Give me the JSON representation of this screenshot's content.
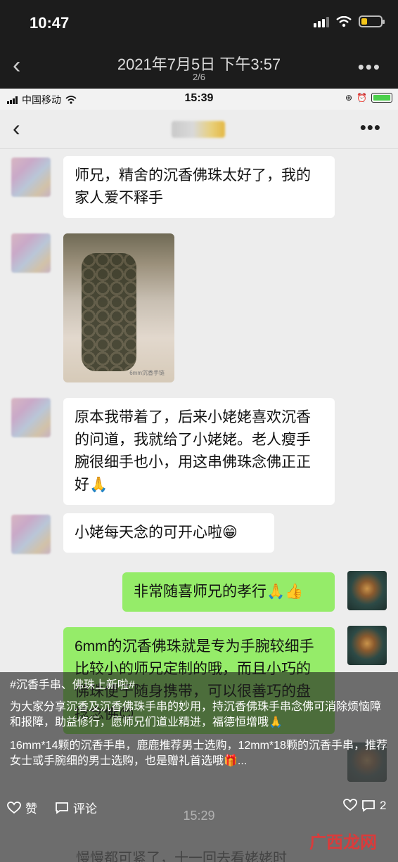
{
  "outer_status": {
    "time": "10:47"
  },
  "viewer": {
    "back": "‹",
    "title": "2021年7月5日 下午3:57",
    "count": "2/6",
    "more": "•••"
  },
  "inner_status": {
    "carrier": "中国移动",
    "time": "15:39"
  },
  "chat": {
    "back": "‹",
    "more": "•••",
    "messages": [
      {
        "side": "left",
        "text": "师兄，精舍的沉香佛珠太好了，我的家人爱不释手"
      },
      {
        "side": "left",
        "type": "image",
        "caption": "6mm沉香手链"
      },
      {
        "side": "left",
        "text": "原本我带着了，后来小姥姥喜欢沉香的问道，我就给了小姥姥。老人瘦手腕很细手也小，用这串佛珠念佛正正好🙏"
      },
      {
        "side": "left",
        "text": "小姥每天念的可开心啦😁"
      },
      {
        "side": "right",
        "text": "非常随喜师兄的孝行🙏👍"
      },
      {
        "side": "right",
        "text": "6mm的沉香佛珠就是专为手腕较细手比较小的师兄定制的哦，而且小巧的佛珠便于随身携带，可以很善巧的盘捻念佛😊"
      }
    ],
    "partial_time": "15:29",
    "partial_bottom": "慢慢都可紧了，十一回去看姥姥时"
  },
  "post": {
    "tags": "#沉香手串、佛珠上新啦#",
    "para1": "为大家分享沉香及沉香佛珠手串的妙用，持沉香佛珠手串念佛可消除烦恼障和报障，助益修行，愿师兄们道业精进，福德恒增哦🙏",
    "para2": "16mm*14颗的沉香手串，鹿鹿推荐男士选购，12mm*18颗的沉香手串，推荐女士或手腕细的男士选购，也是赠礼首选哦🎁...",
    "like_label": "赞",
    "comment_label": "评论",
    "comment_count": "2"
  },
  "watermark": "广西龙网"
}
